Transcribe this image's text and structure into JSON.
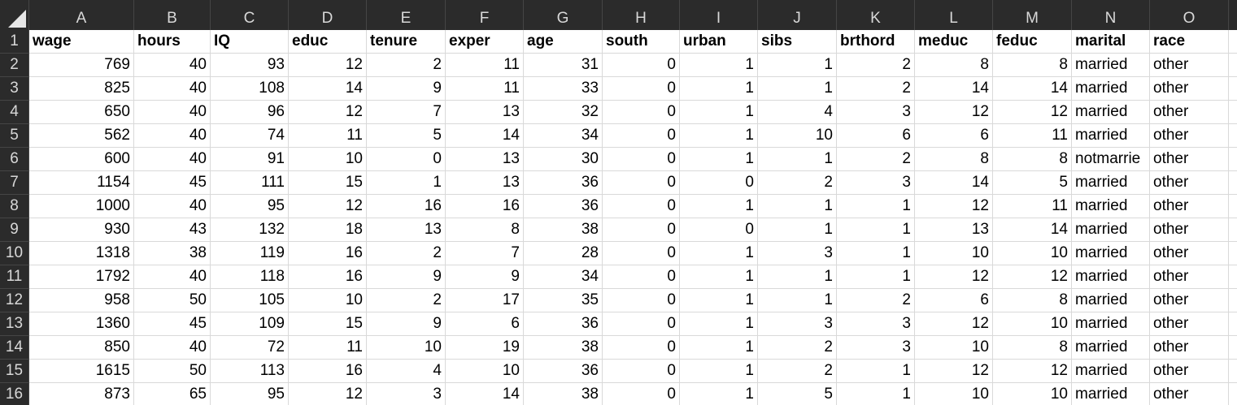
{
  "columns": [
    "A",
    "B",
    "C",
    "D",
    "E",
    "F",
    "G",
    "H",
    "I",
    "J",
    "K",
    "L",
    "M",
    "N",
    "O"
  ],
  "header": [
    "wage",
    "hours",
    "IQ",
    "educ",
    "tenure",
    "exper",
    "age",
    "south",
    "urban",
    "sibs",
    "brthord",
    "meduc",
    "feduc",
    "marital",
    "race"
  ],
  "rows": [
    {
      "n": "2",
      "v": [
        "769",
        "40",
        "93",
        "12",
        "2",
        "11",
        "31",
        "0",
        "1",
        "1",
        "2",
        "8",
        "8",
        "married",
        "other"
      ]
    },
    {
      "n": "3",
      "v": [
        "825",
        "40",
        "108",
        "14",
        "9",
        "11",
        "33",
        "0",
        "1",
        "1",
        "2",
        "14",
        "14",
        "married",
        "other"
      ]
    },
    {
      "n": "4",
      "v": [
        "650",
        "40",
        "96",
        "12",
        "7",
        "13",
        "32",
        "0",
        "1",
        "4",
        "3",
        "12",
        "12",
        "married",
        "other"
      ]
    },
    {
      "n": "5",
      "v": [
        "562",
        "40",
        "74",
        "11",
        "5",
        "14",
        "34",
        "0",
        "1",
        "10",
        "6",
        "6",
        "11",
        "married",
        "other"
      ]
    },
    {
      "n": "6",
      "v": [
        "600",
        "40",
        "91",
        "10",
        "0",
        "13",
        "30",
        "0",
        "1",
        "1",
        "2",
        "8",
        "8",
        "notmarrie",
        "other"
      ]
    },
    {
      "n": "7",
      "v": [
        "1154",
        "45",
        "111",
        "15",
        "1",
        "13",
        "36",
        "0",
        "0",
        "2",
        "3",
        "14",
        "5",
        "married",
        "other"
      ]
    },
    {
      "n": "8",
      "v": [
        "1000",
        "40",
        "95",
        "12",
        "16",
        "16",
        "36",
        "0",
        "1",
        "1",
        "1",
        "12",
        "11",
        "married",
        "other"
      ]
    },
    {
      "n": "9",
      "v": [
        "930",
        "43",
        "132",
        "18",
        "13",
        "8",
        "38",
        "0",
        "0",
        "1",
        "1",
        "13",
        "14",
        "married",
        "other"
      ]
    },
    {
      "n": "10",
      "v": [
        "1318",
        "38",
        "119",
        "16",
        "2",
        "7",
        "28",
        "0",
        "1",
        "3",
        "1",
        "10",
        "10",
        "married",
        "other"
      ]
    },
    {
      "n": "11",
      "v": [
        "1792",
        "40",
        "118",
        "16",
        "9",
        "9",
        "34",
        "0",
        "1",
        "1",
        "1",
        "12",
        "12",
        "married",
        "other"
      ]
    },
    {
      "n": "12",
      "v": [
        "958",
        "50",
        "105",
        "10",
        "2",
        "17",
        "35",
        "0",
        "1",
        "1",
        "2",
        "6",
        "8",
        "married",
        "other"
      ]
    },
    {
      "n": "13",
      "v": [
        "1360",
        "45",
        "109",
        "15",
        "9",
        "6",
        "36",
        "0",
        "1",
        "3",
        "3",
        "12",
        "10",
        "married",
        "other"
      ]
    },
    {
      "n": "14",
      "v": [
        "850",
        "40",
        "72",
        "11",
        "10",
        "19",
        "38",
        "0",
        "1",
        "2",
        "3",
        "10",
        "8",
        "married",
        "other"
      ]
    },
    {
      "n": "15",
      "v": [
        "1615",
        "50",
        "113",
        "16",
        "4",
        "10",
        "36",
        "0",
        "1",
        "2",
        "1",
        "12",
        "12",
        "married",
        "other"
      ]
    },
    {
      "n": "16",
      "v": [
        "873",
        "65",
        "95",
        "12",
        "3",
        "14",
        "38",
        "0",
        "1",
        "5",
        "1",
        "10",
        "10",
        "married",
        "other"
      ]
    }
  ],
  "header_row_num": "1",
  "colors": {
    "header_bg": "#2b2b2b",
    "header_text": "#d8d8d8",
    "grid": "#d9d9d9"
  }
}
